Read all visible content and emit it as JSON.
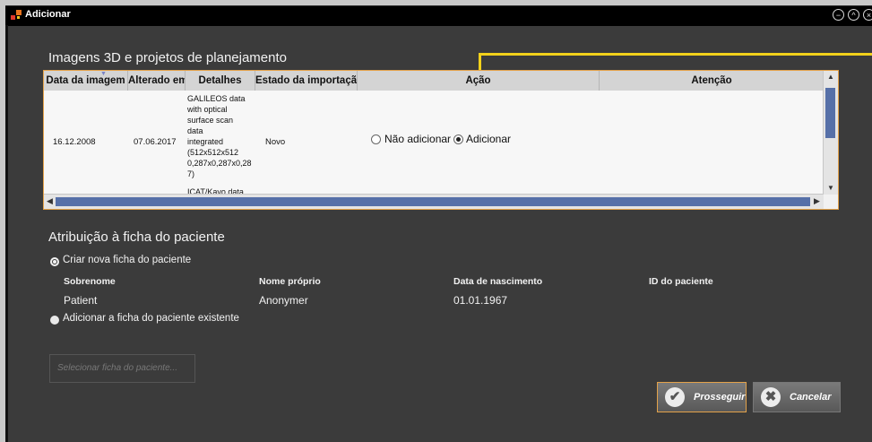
{
  "window": {
    "title": "Adicionar",
    "controls": [
      "−",
      "^",
      "×"
    ]
  },
  "section_images": {
    "heading": "Imagens 3D e projetos de planejamento",
    "columns": [
      "Data da imagem",
      "Alterado em",
      "Detalhes",
      "Estado da importação",
      "Ação",
      "Atenção"
    ],
    "row": {
      "date": "16.12.2008",
      "changed": "07.06.2017",
      "details_lines": [
        "GALILEOS data",
        "with optical",
        "surface scan data",
        "integrated",
        "(512x512x512",
        "0,287x0,287x0,28",
        "7)"
      ],
      "details_extra": "ICAT/Kavo data",
      "status": "Novo",
      "action_options": [
        "Não adicionar",
        "Adicionar"
      ],
      "action_selected": "Adicionar"
    }
  },
  "section_patient": {
    "heading": "Atribuição à ficha do paciente",
    "option_new": "Criar nova ficha do paciente",
    "labels": {
      "surname": "Sobrenome",
      "given": "Nome próprio",
      "dob": "Data de nascimento",
      "id": "ID do paciente"
    },
    "values": {
      "surname": "Patient",
      "given": "Anonymer",
      "dob": "01.01.1967",
      "id": ""
    },
    "option_existing": "Adicionar a ficha do paciente existente",
    "select_placeholder": "Selecionar ficha do paciente..."
  },
  "buttons": {
    "proceed": "Prosseguir",
    "cancel": "Cancelar"
  },
  "colors": {
    "accent": "#e3a24a",
    "callout": "#f2d11b",
    "scroll_thumb": "#5670a8"
  }
}
